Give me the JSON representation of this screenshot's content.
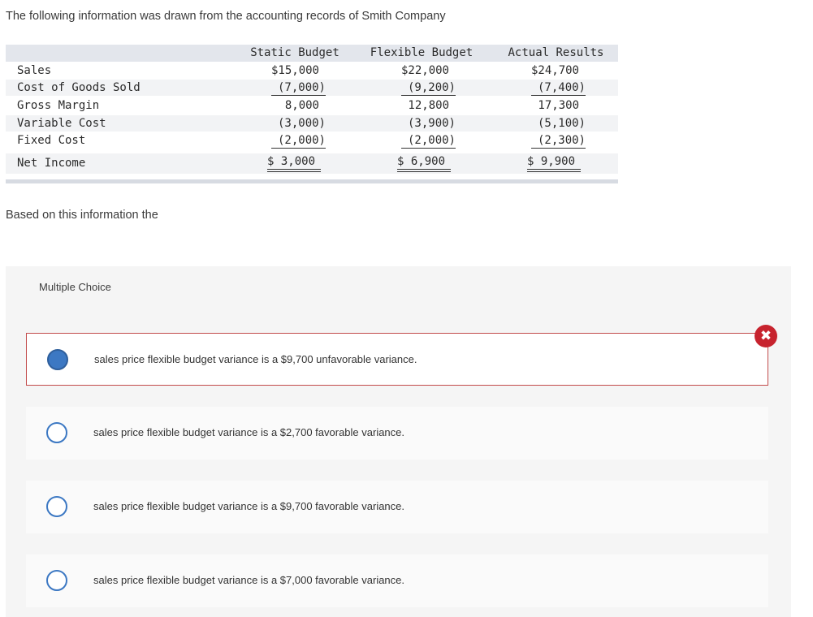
{
  "intro": "The following information was drawn from the accounting records of Smith Company",
  "table": {
    "columns": [
      "Static Budget",
      "Flexible Budget",
      "Actual Results"
    ],
    "rows": [
      {
        "label": "Sales",
        "static": "$15,000",
        "flexible": "$22,000",
        "actual": "$24,700"
      },
      {
        "label": "Cost of Goods Sold",
        "static": "(7,000)",
        "flexible": "(9,200)",
        "actual": "(7,400)"
      },
      {
        "label": "Gross Margin",
        "static": "8,000",
        "flexible": "12,800",
        "actual": "17,300"
      },
      {
        "label": "Variable Cost",
        "static": "(3,000)",
        "flexible": "(3,900)",
        "actual": "(5,100)"
      },
      {
        "label": "Fixed Cost",
        "static": "(2,000)",
        "flexible": "(2,000)",
        "actual": "(2,300)"
      },
      {
        "label": "Net Income",
        "static": "$ 3,000",
        "flexible": "$ 6,900",
        "actual": "$ 9,900"
      }
    ]
  },
  "lead": "Based on this information the",
  "multiple_choice": {
    "title": "Multiple Choice",
    "options": [
      {
        "text": "sales price flexible budget variance is a $9,700 unfavorable variance.",
        "selected": true
      },
      {
        "text": "sales price flexible budget variance is a $2,700 favorable variance.",
        "selected": false
      },
      {
        "text": "sales price flexible budget variance is a $9,700 favorable variance.",
        "selected": false
      },
      {
        "text": "sales price flexible budget variance is a $7,000 favorable variance.",
        "selected": false
      }
    ],
    "result_icon": "incorrect-x-icon",
    "colors": {
      "radio": "#3c78c3",
      "wrong": "#c7232e",
      "selected_border": "#c24b4b"
    }
  }
}
